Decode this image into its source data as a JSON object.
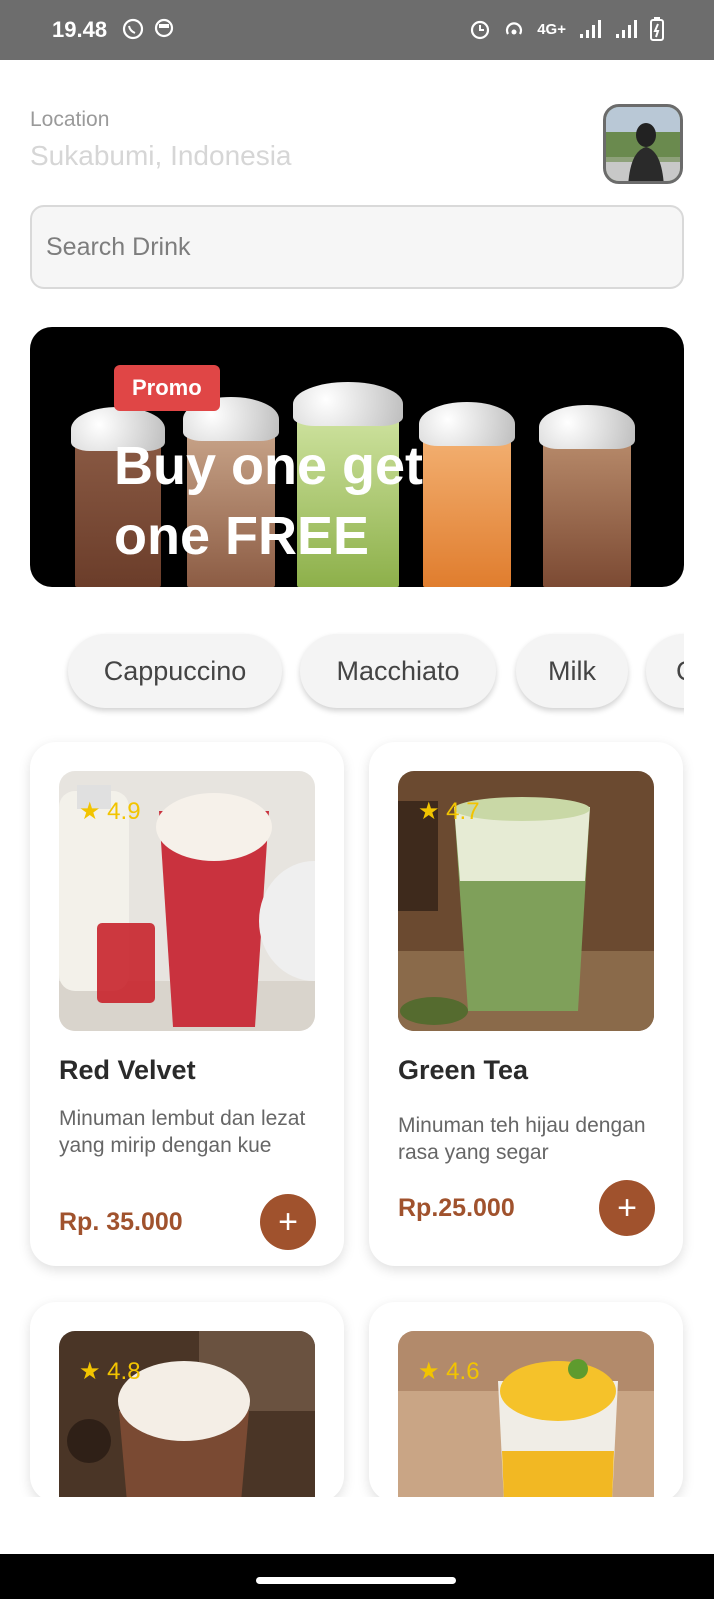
{
  "status_bar": {
    "time": "19.48",
    "network": "4G+",
    "icons": [
      "whatsapp-icon",
      "circle-app-icon",
      "alarm-icon",
      "hotspot-icon",
      "signal-icon",
      "signal-icon",
      "battery-icon"
    ]
  },
  "location": {
    "label": "Location",
    "value": "Sukabumi, Indonesia"
  },
  "search": {
    "placeholder": "Search Drink"
  },
  "banner": {
    "tag": "Promo",
    "title": "Buy one get one FREE"
  },
  "categories": [
    "Cappuccino",
    "Macchiato",
    "Milk",
    "C"
  ],
  "products": [
    {
      "name": "Red Velvet",
      "rating": "★ 4.9",
      "description": "Minuman lembut dan lezat yang mirip dengan kue",
      "price": "Rp. 35.000",
      "add_label": "+"
    },
    {
      "name": "Green Tea",
      "rating": "★ 4.7",
      "description": "Minuman teh hijau dengan rasa yang segar",
      "price": "Rp.25.000",
      "add_label": "+"
    },
    {
      "name": "",
      "rating": "★ 4.8",
      "description": "",
      "price": "",
      "add_label": ""
    },
    {
      "name": "",
      "rating": "★ 4.6",
      "description": "",
      "price": "",
      "add_label": ""
    }
  ],
  "colors": {
    "accent": "#a0522d",
    "promo": "#e04646",
    "rating": "#f2c400",
    "status_bar": "#6d6d6d"
  }
}
